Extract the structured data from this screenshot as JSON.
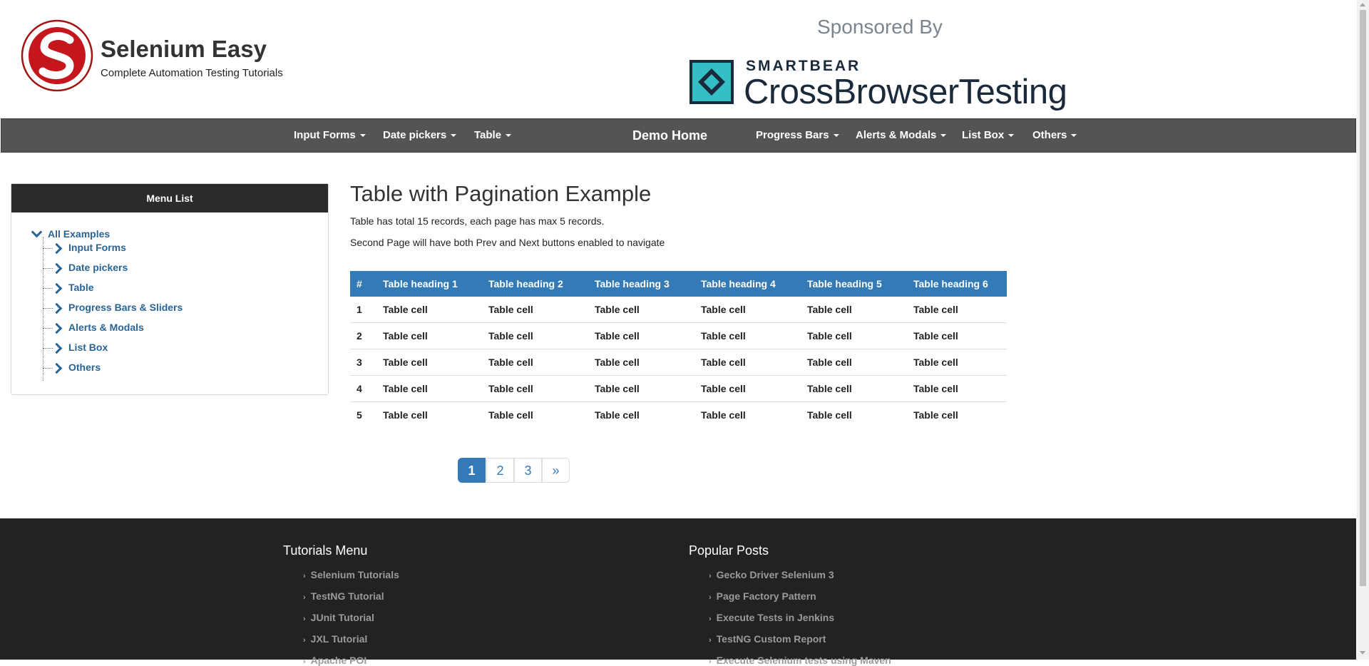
{
  "header": {
    "brand_title": "Selenium Easy",
    "brand_subtitle": "Complete Automation Testing Tutorials",
    "sponsored_by": "Sponsored By",
    "sponsor_small": "SMARTBEAR",
    "sponsor_big": "CrossBrowserTesting",
    "logo_icon": "selenium-easy-logo-icon",
    "sponsor_icon": "crossbrowsertesting-logo-icon"
  },
  "nav": {
    "items_left": [
      "Input Forms",
      "Date pickers",
      "Table"
    ],
    "home": "Demo Home",
    "items_right": [
      "Progress Bars",
      "Alerts & Modals",
      "List Box",
      "Others"
    ]
  },
  "sidebar": {
    "title": "Menu List",
    "root": "All Examples",
    "items": [
      "Input Forms",
      "Date pickers",
      "Table",
      "Progress Bars & Sliders",
      "Alerts & Modals",
      "List Box",
      "Others"
    ]
  },
  "main": {
    "title": "Table with Pagination Example",
    "desc1": "Table has total 15 records, each page has max 5 records.",
    "desc2": "Second Page will have both Prev and Next buttons enabled to navigate"
  },
  "table": {
    "headers": [
      "#",
      "Table heading 1",
      "Table heading 2",
      "Table heading 3",
      "Table heading 4",
      "Table heading 5",
      "Table heading 6"
    ],
    "rows": [
      [
        "1",
        "Table cell",
        "Table cell",
        "Table cell",
        "Table cell",
        "Table cell",
        "Table cell"
      ],
      [
        "2",
        "Table cell",
        "Table cell",
        "Table cell",
        "Table cell",
        "Table cell",
        "Table cell"
      ],
      [
        "3",
        "Table cell",
        "Table cell",
        "Table cell",
        "Table cell",
        "Table cell",
        "Table cell"
      ],
      [
        "4",
        "Table cell",
        "Table cell",
        "Table cell",
        "Table cell",
        "Table cell",
        "Table cell"
      ],
      [
        "5",
        "Table cell",
        "Table cell",
        "Table cell",
        "Table cell",
        "Table cell",
        "Table cell"
      ]
    ]
  },
  "pagination": {
    "pages": [
      "1",
      "2",
      "3",
      "»"
    ],
    "active": "1"
  },
  "footer": {
    "tutorials_title": "Tutorials Menu",
    "tutorials": [
      "Selenium Tutorials",
      "TestNG Tutorial",
      "JUnit Tutorial",
      "JXL Tutorial",
      "Apache POI"
    ],
    "popular_title": "Popular Posts",
    "popular": [
      "Gecko Driver Selenium 3",
      "Page Factory Pattern",
      "Execute Tests in Jenkins",
      "TestNG Custom Report",
      "Execute Selenium tests using Maven"
    ]
  },
  "colors": {
    "navbar_bg": "#545454",
    "primary": "#337ab7",
    "link": "#2a6496",
    "footer_bg": "#222222"
  }
}
